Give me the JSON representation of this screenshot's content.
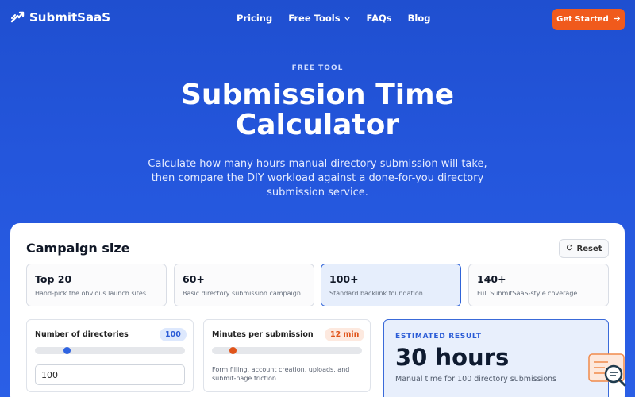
{
  "nav": {
    "brand": "SubmitSaaS",
    "logo_icon": "s-arrow-logo-icon",
    "links": [
      "Pricing",
      "Free Tools",
      "FAQs",
      "Blog"
    ],
    "cta_label": "Get Started"
  },
  "hero": {
    "eyebrow": "FREE TOOL",
    "title_line1": "Submission Time",
    "title_line2": "Calculator",
    "subtitle": "Calculate how many hours manual directory submission will take, then compare the DIY workload against a done-for-you directory submission service."
  },
  "campaign": {
    "title": "Campaign size",
    "reset_label": "Reset",
    "presets": [
      {
        "title": "Top 20",
        "desc": "Hand-pick the obvious launch sites"
      },
      {
        "title": "60+",
        "desc": "Basic directory submission campaign"
      },
      {
        "title": "100+",
        "desc": "Standard backlink foundation"
      },
      {
        "title": "140+",
        "desc": "Full SubmitSaaS-style coverage"
      }
    ],
    "selected_preset": "100+"
  },
  "directories": {
    "label": "Number of directories",
    "badge": "100",
    "input_value": "100",
    "slider_fraction": 0.2
  },
  "minutes": {
    "label": "Minutes per submission",
    "badge": "12 min",
    "hint": "Form filling, account creation, uploads, and submit-page friction.",
    "slider_fraction": 0.12
  },
  "result": {
    "label": "ESTIMATED RESULT",
    "value": "30 hours",
    "subtext": "Manual time for 100 directory submissions"
  },
  "colors": {
    "primary": "#2456dc",
    "accent_orange": "#f05a1c",
    "slider_blue": "#2f63e0",
    "slider_orange": "#e0541a"
  }
}
